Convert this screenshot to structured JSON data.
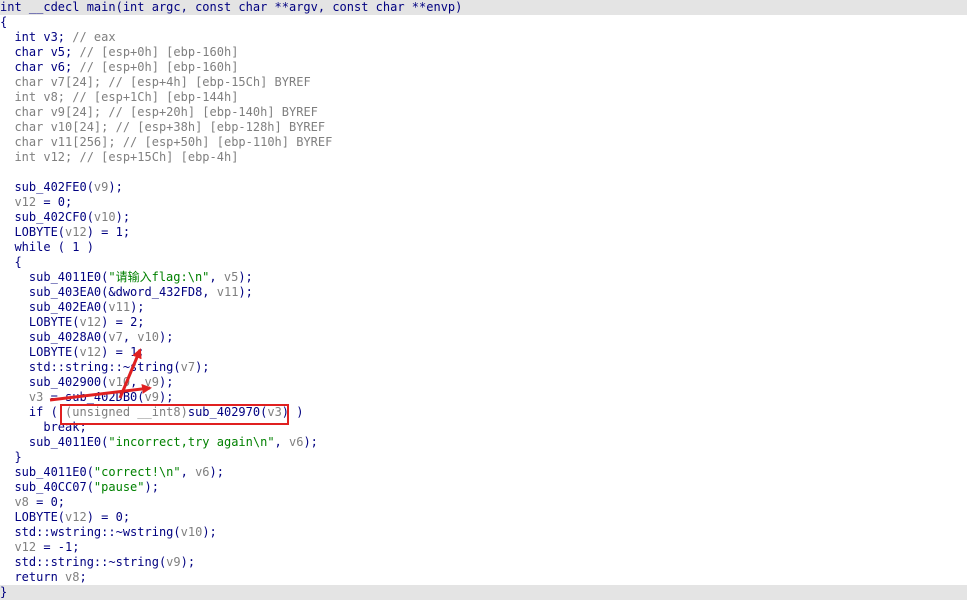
{
  "colors": {
    "keyword": "#000080",
    "comment": "#7f7f7f",
    "string": "#008000",
    "variable": "#7f7f7f",
    "highlight_bg": "#e4e4e4",
    "annotation": "#e02020"
  },
  "lines": [
    [
      [
        "p",
        "int __cdecl main(int argc, const char **argv, const char **envp)"
      ]
    ],
    [
      [
        "p",
        "{"
      ]
    ],
    [
      [
        "p",
        "  int v3; "
      ],
      [
        "c",
        "// eax"
      ]
    ],
    [
      [
        "p",
        "  char v5; "
      ],
      [
        "c",
        "// [esp+0h] [ebp-160h]"
      ]
    ],
    [
      [
        "p",
        "  char v6; "
      ],
      [
        "c",
        "// [esp+0h] [ebp-160h]"
      ]
    ],
    [
      [
        "v",
        "  char v7[24]; "
      ],
      [
        "c",
        "// [esp+4h] [ebp-15Ch] BYREF"
      ]
    ],
    [
      [
        "v",
        "  int v8; "
      ],
      [
        "c",
        "// [esp+1Ch] [ebp-144h]"
      ]
    ],
    [
      [
        "v",
        "  char v9[24]; "
      ],
      [
        "c",
        "// [esp+20h] [ebp-140h] BYREF"
      ]
    ],
    [
      [
        "v",
        "  char v10[24]; "
      ],
      [
        "c",
        "// [esp+38h] [ebp-128h] BYREF"
      ]
    ],
    [
      [
        "v",
        "  char v11[256]; "
      ],
      [
        "c",
        "// [esp+50h] [ebp-110h] BYREF"
      ]
    ],
    [
      [
        "v",
        "  int v12; "
      ],
      [
        "c",
        "// [esp+15Ch] [ebp-4h]"
      ]
    ],
    [
      [
        "p",
        ""
      ]
    ],
    [
      [
        "p",
        "  sub_402FE0("
      ],
      [
        "v",
        "v9"
      ],
      [
        "p",
        ");"
      ]
    ],
    [
      [
        "v",
        "  v12"
      ],
      [
        "p",
        " = 0;"
      ]
    ],
    [
      [
        "p",
        "  sub_402CF0("
      ],
      [
        "v",
        "v10"
      ],
      [
        "p",
        ");"
      ]
    ],
    [
      [
        "p",
        "  LOBYTE("
      ],
      [
        "v",
        "v12"
      ],
      [
        "p",
        ") = 1;"
      ]
    ],
    [
      [
        "p",
        "  while ( 1 )"
      ]
    ],
    [
      [
        "p",
        "  {"
      ]
    ],
    [
      [
        "p",
        "    sub_4011E0("
      ],
      [
        "s",
        "\"请输入flag:\\n\""
      ],
      [
        "p",
        ", "
      ],
      [
        "v",
        "v5"
      ],
      [
        "p",
        ");"
      ]
    ],
    [
      [
        "p",
        "    sub_403EA0(&dword_432FD8, "
      ],
      [
        "v",
        "v11"
      ],
      [
        "p",
        ");"
      ]
    ],
    [
      [
        "p",
        "    sub_402EA0("
      ],
      [
        "v",
        "v11"
      ],
      [
        "p",
        ");"
      ]
    ],
    [
      [
        "p",
        "    LOBYTE("
      ],
      [
        "v",
        "v12"
      ],
      [
        "p",
        ") = 2;"
      ]
    ],
    [
      [
        "p",
        "    sub_4028A0("
      ],
      [
        "v",
        "v7"
      ],
      [
        "p",
        ", "
      ],
      [
        "v",
        "v10"
      ],
      [
        "p",
        ");"
      ]
    ],
    [
      [
        "p",
        "    LOBYTE("
      ],
      [
        "v",
        "v12"
      ],
      [
        "p",
        ") = 1;"
      ]
    ],
    [
      [
        "p",
        "    std::string::~string("
      ],
      [
        "v",
        "v7"
      ],
      [
        "p",
        ");"
      ]
    ],
    [
      [
        "p",
        "    sub_402900("
      ],
      [
        "v",
        "v10"
      ],
      [
        "p",
        ", "
      ],
      [
        "v",
        "v9"
      ],
      [
        "p",
        ");"
      ]
    ],
    [
      [
        "v",
        "    v3"
      ],
      [
        "p",
        " = sub_402DB0("
      ],
      [
        "v",
        "v9"
      ],
      [
        "p",
        ");"
      ]
    ],
    [
      [
        "p",
        "    if ( "
      ],
      [
        "v",
        "(unsigned __int8)"
      ],
      [
        "p",
        "sub_402970("
      ],
      [
        "v",
        "v3"
      ],
      [
        "p",
        ") )"
      ]
    ],
    [
      [
        "p",
        "      break;"
      ]
    ],
    [
      [
        "p",
        "    sub_4011E0("
      ],
      [
        "s",
        "\"incorrect,try again\\n\""
      ],
      [
        "p",
        ", "
      ],
      [
        "v",
        "v6"
      ],
      [
        "p",
        ");"
      ]
    ],
    [
      [
        "p",
        "  }"
      ]
    ],
    [
      [
        "p",
        "  sub_4011E0("
      ],
      [
        "s",
        "\"correct!\\n\""
      ],
      [
        "p",
        ", "
      ],
      [
        "v",
        "v6"
      ],
      [
        "p",
        ");"
      ]
    ],
    [
      [
        "p",
        "  sub_40CC07("
      ],
      [
        "s",
        "\"pause\""
      ],
      [
        "p",
        ");"
      ]
    ],
    [
      [
        "v",
        "  v8"
      ],
      [
        "p",
        " = 0;"
      ]
    ],
    [
      [
        "p",
        "  LOBYTE("
      ],
      [
        "v",
        "v12"
      ],
      [
        "p",
        ") = 0;"
      ]
    ],
    [
      [
        "p",
        "  std::wstring::~wstring("
      ],
      [
        "v",
        "v10"
      ],
      [
        "p",
        ");"
      ]
    ],
    [
      [
        "v",
        "  v12"
      ],
      [
        "p",
        " = -1;"
      ]
    ],
    [
      [
        "p",
        "  std::string::~string("
      ],
      [
        "v",
        "v9"
      ],
      [
        "p",
        ");"
      ]
    ],
    [
      [
        "p",
        "  return "
      ],
      [
        "v",
        "v8"
      ],
      [
        "p",
        ";"
      ]
    ],
    [
      [
        "p",
        "}"
      ]
    ]
  ],
  "highlighted_lines": [
    0,
    39
  ]
}
